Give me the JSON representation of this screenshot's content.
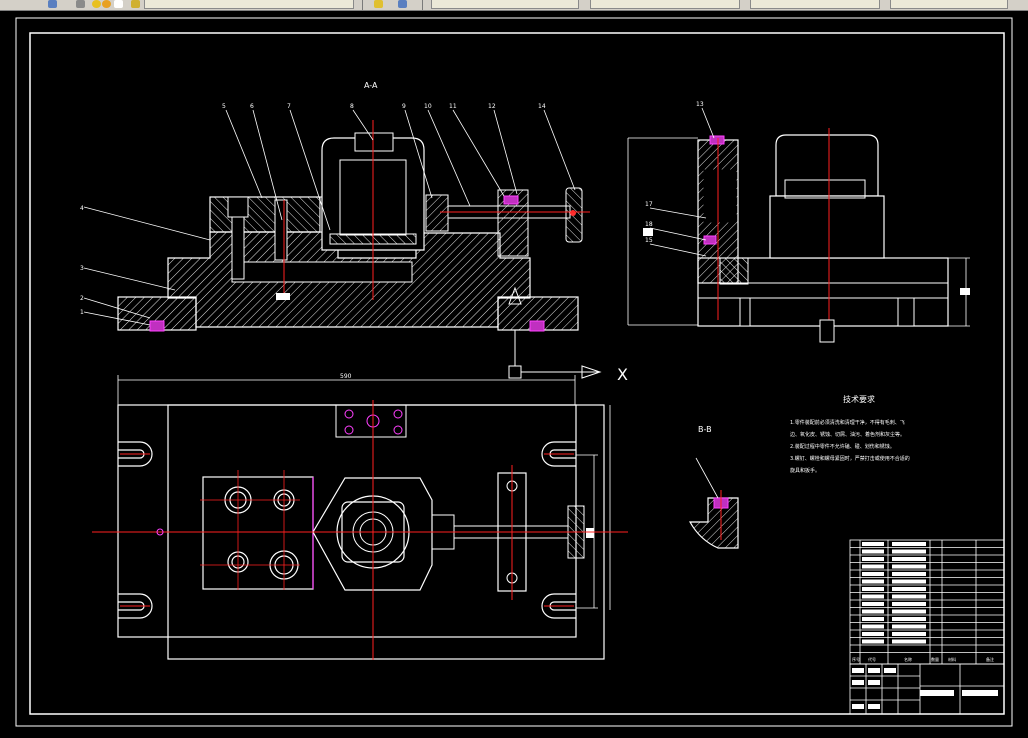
{
  "toolbar": {
    "left_file_label": "",
    "layout_label": "",
    "style_labels": [
      "",
      "",
      ""
    ],
    "search_label": ""
  },
  "drawing": {
    "section_aa_label": "A-A",
    "section_bb_label": "B-B",
    "axis_x_label": "X",
    "overall_width_dim": "590",
    "part_numbers": [
      "5",
      "6",
      "7",
      "8",
      "9",
      "10",
      "11",
      "12",
      "14",
      "4",
      "3",
      "2",
      "1"
    ],
    "side_part_numbers": [
      "13",
      "17",
      "18",
      "15"
    ],
    "tech_title": "技术要求",
    "tech_lines": [
      "1.零件装配前必须清洗和清理干净，不得有毛刺、飞",
      "边、氧化皮、锈蚀、切屑、油污、着色剂和灰尘等。",
      "2.装配过程中零件不允许磕、碰、划伤和锈蚀。",
      "3.螺钉、螺栓和螺母紧固时，严禁打击或使用不合适的",
      "旋具和扳手。"
    ],
    "title_block_cells": [
      "序号",
      "代号",
      "名称",
      "数量",
      "材料",
      "备注"
    ]
  },
  "colors": {
    "background": "#000000",
    "line_white": "#ffffff",
    "center_red": "#ff2020",
    "magenta": "#ff40ff",
    "toolbar_gray": "#d4d0c8"
  }
}
